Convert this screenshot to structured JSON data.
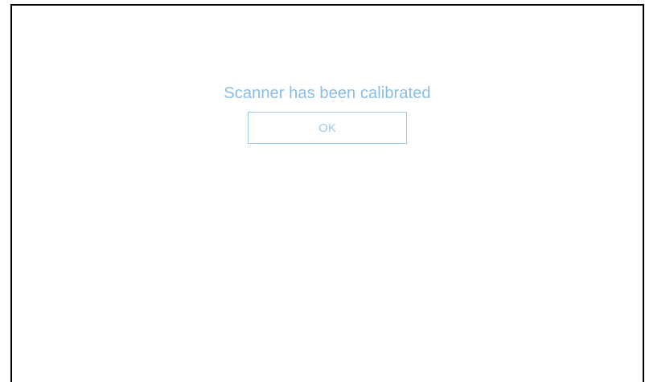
{
  "dialog": {
    "message": "Scanner has been calibrated",
    "ok_label": "OK"
  },
  "colors": {
    "message_text": "#88bde6",
    "button_border": "#9fcbec",
    "frame_border": "#000000",
    "background": "#ffffff"
  }
}
